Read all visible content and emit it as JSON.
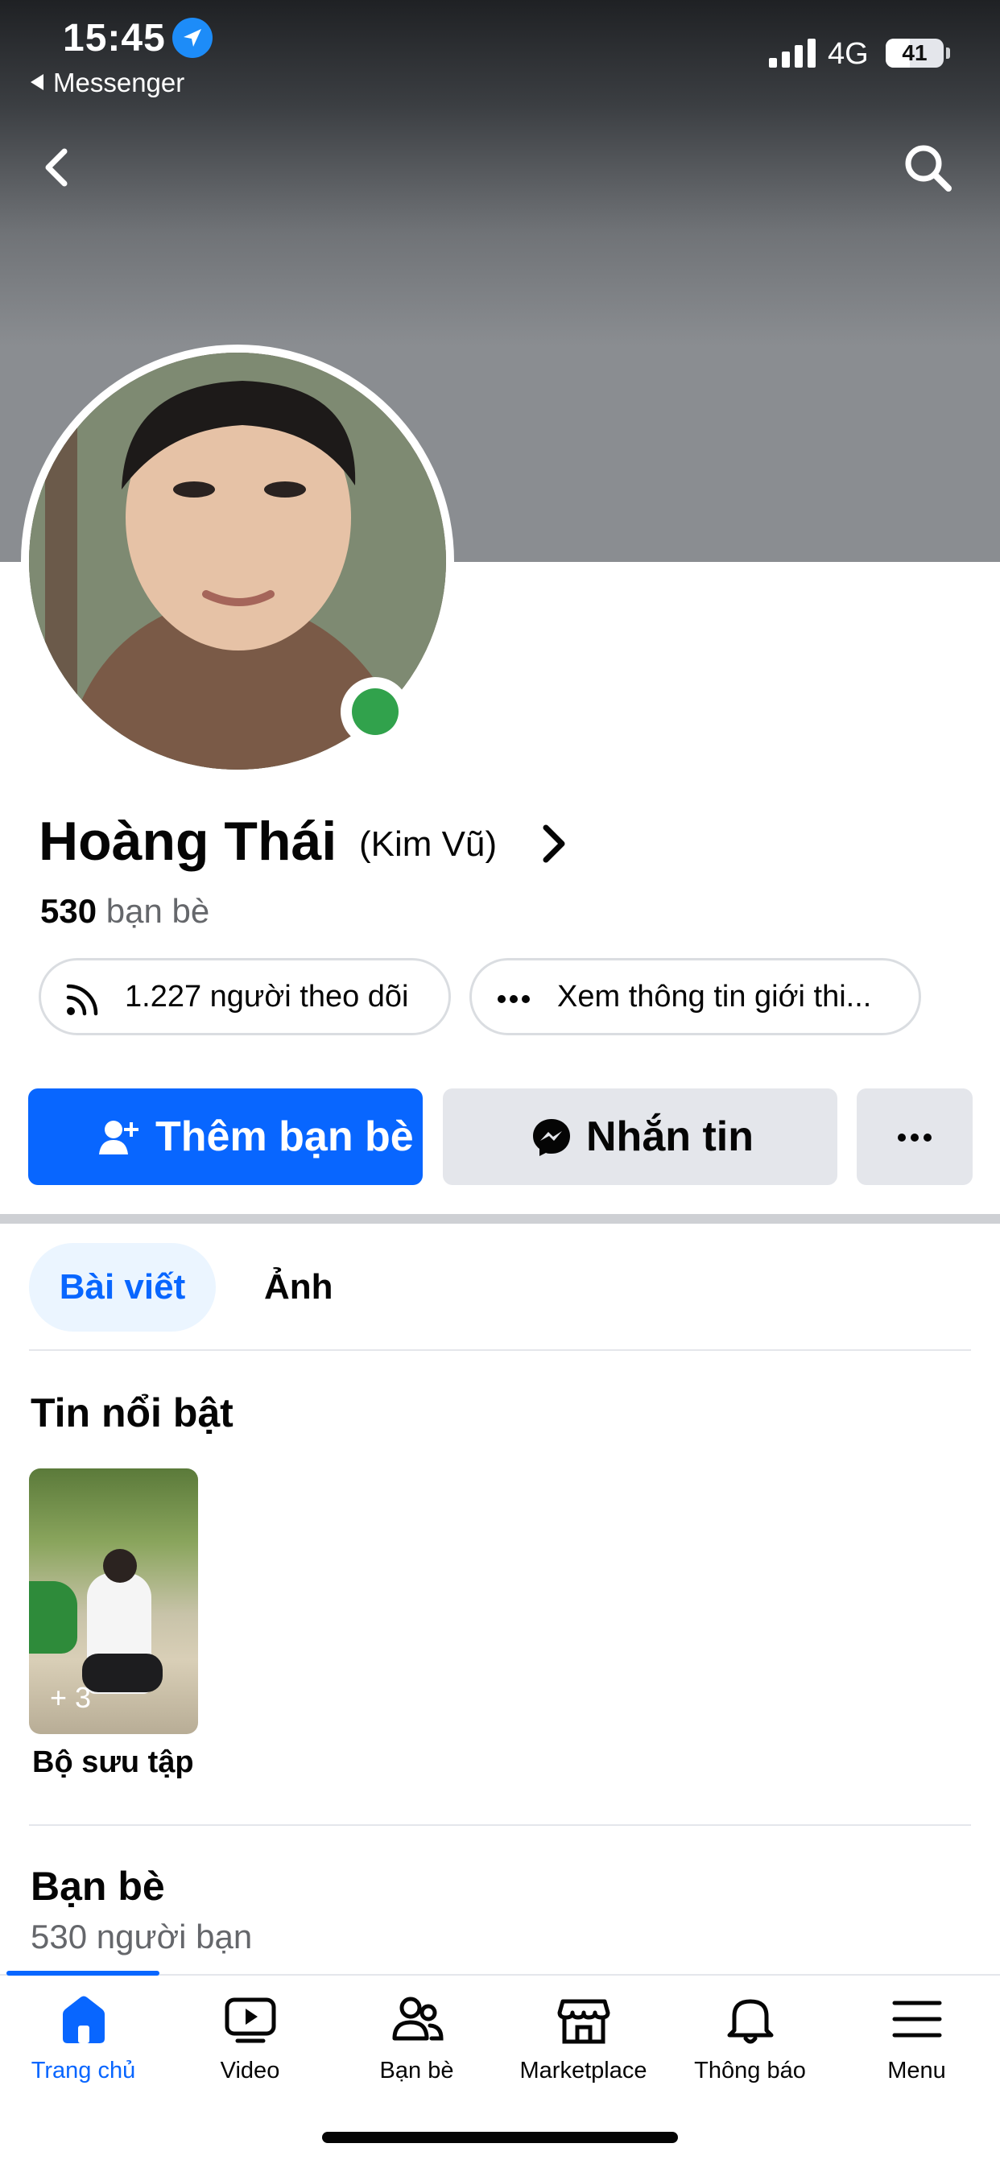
{
  "status_bar": {
    "time": "15:45",
    "back_app": "Messenger",
    "network": "4G",
    "battery": "41"
  },
  "profile": {
    "name": "Hoàng Thái",
    "alternate_name": "(Kim Vũ)",
    "friends_count": "530",
    "friends_label": "bạn bè",
    "online": true
  },
  "pills": {
    "followers": "1.227 người theo dõi",
    "about": "Xem thông tin giới thi..."
  },
  "actions": {
    "add_friend": "Thêm bạn bè",
    "message": "Nhắn tin"
  },
  "tabs": [
    {
      "label": "Bài viết",
      "active": true
    },
    {
      "label": "Ảnh",
      "active": false
    }
  ],
  "highlights": {
    "title": "Tin nổi bật",
    "items": [
      {
        "label": "Bộ sưu tập",
        "count": "+ 3"
      }
    ]
  },
  "friends_section": {
    "title": "Bạn bè",
    "subtitle": "530 người bạn"
  },
  "bottom_nav": [
    {
      "label": "Trang chủ",
      "icon": "home-icon",
      "active": true
    },
    {
      "label": "Video",
      "icon": "video-icon",
      "active": false
    },
    {
      "label": "Bạn bè",
      "icon": "friends-icon",
      "active": false
    },
    {
      "label": "Marketplace",
      "icon": "marketplace-icon",
      "active": false
    },
    {
      "label": "Thông báo",
      "icon": "bell-icon",
      "active": false
    },
    {
      "label": "Menu",
      "icon": "menu-icon",
      "active": false
    }
  ],
  "colors": {
    "accent": "#0866ff",
    "online": "#31a24c",
    "secondary_text": "#65676b",
    "button_grey": "#e4e6eb"
  }
}
